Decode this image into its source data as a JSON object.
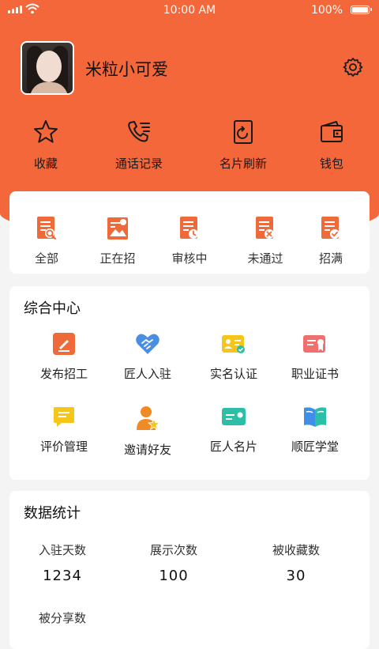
{
  "status_bar": {
    "time": "10:00 AM",
    "battery": "100%"
  },
  "profile": {
    "username": "米粒小可爱"
  },
  "quick_actions": [
    {
      "label": "收藏",
      "icon": "star-icon"
    },
    {
      "label": "通话记录",
      "icon": "phone-log-icon"
    },
    {
      "label": "名片刷新",
      "icon": "card-refresh-icon"
    },
    {
      "label": "钱包",
      "icon": "wallet-icon"
    }
  ],
  "job_status": [
    {
      "label": "全部",
      "icon": "doc-search-icon"
    },
    {
      "label": "正在招",
      "icon": "doc-landscape-icon"
    },
    {
      "label": "审核中",
      "icon": "doc-clock-icon"
    },
    {
      "label": "未通过",
      "icon": "doc-x-icon"
    },
    {
      "label": "招满",
      "icon": "doc-check-icon"
    }
  ],
  "center": {
    "title": "综合中心",
    "items": [
      {
        "label": "发布招工",
        "icon": "post-job-icon"
      },
      {
        "label": "匠人入驻",
        "icon": "handshake-icon"
      },
      {
        "label": "实名认证",
        "icon": "id-verify-icon"
      },
      {
        "label": "职业证书",
        "icon": "certificate-icon"
      },
      {
        "label": "评价管理",
        "icon": "comment-icon"
      },
      {
        "label": "邀请好友",
        "icon": "invite-friend-icon"
      },
      {
        "label": "匠人名片",
        "icon": "name-card-icon"
      },
      {
        "label": "顺匠学堂",
        "icon": "book-icon"
      }
    ]
  },
  "stats": {
    "title": "数据统计",
    "items": [
      {
        "label": "入驻天数",
        "value": "1234"
      },
      {
        "label": "展示次数",
        "value": "100"
      },
      {
        "label": "被收藏数",
        "value": "30"
      },
      {
        "label": "被分享数",
        "value": ""
      }
    ]
  },
  "colors": {
    "brand": "#f4673a",
    "icon_orange": "#ef6a3a",
    "teal": "#2bbfa8",
    "blue": "#3f8ee8",
    "yellow": "#f5c51a"
  }
}
